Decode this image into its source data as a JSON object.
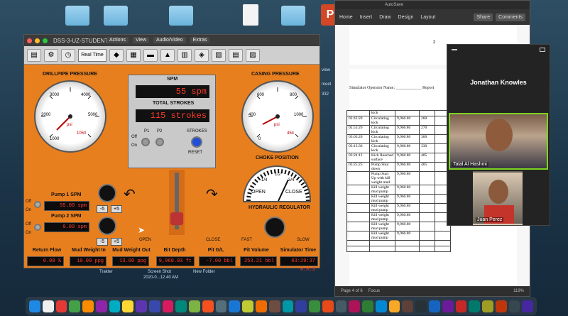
{
  "simulator": {
    "window_title": "DSS-3-UZ-STUDENT1",
    "vnc_menu": [
      "Actions",
      "View",
      "Audio/Video",
      "Extras"
    ],
    "toolbar": {
      "real_time": "Real Time"
    },
    "drillpipe": {
      "label": "DRILLPIPE PRESSURE",
      "value": "1050",
      "ticks": [
        "0",
        "1000",
        "2000",
        "3000",
        "4000",
        "5000",
        "6000"
      ],
      "unit": "psi"
    },
    "casing": {
      "label": "CASING PRESSURE",
      "value": "454",
      "ticks": [
        "0",
        "200",
        "400",
        "600",
        "800",
        "1000",
        "1200"
      ],
      "unit": "psi"
    },
    "spm": {
      "label": "SPM",
      "value": "55 spm"
    },
    "total_strokes": {
      "label": "TOTAL STROKES",
      "value": "115 strokes"
    },
    "p1": "P1",
    "p2": "P2",
    "strokes_reset": "STROKES",
    "reset": "RESET",
    "on": "On",
    "off": "Off",
    "choke": {
      "label": "CHOKE POSITION",
      "open": "OPEN",
      "close": "CLOSE",
      "half": "1/2",
      "q1": "1/4",
      "q3": "3/4"
    },
    "hydraulic": {
      "label": "HYDRAULIC REGULATOR",
      "fast": "FAST",
      "slow": "SLOW"
    },
    "pump1": {
      "label": "Pump 1 SPM",
      "value": "55.00 spm"
    },
    "pump2": {
      "label": "Pump 2 SPM",
      "value": "0.00 spm"
    },
    "minus": "-5",
    "plus": "+5",
    "lever": {
      "open": "OPEN",
      "close": "CLOSE"
    },
    "bottom": [
      {
        "label": "Return Flow",
        "value": "0.00 %"
      },
      {
        "label": "Mud Weight In",
        "value": "10.00 ppg"
      },
      {
        "label": "Mud Weight Out",
        "value": "13.00 ppg"
      },
      {
        "label": "Bit Depth",
        "value": "9,960.03 ft"
      },
      {
        "label": "Pit G/L",
        "value": "-7.00 bbl"
      },
      {
        "label": "Pit Volume",
        "value": "253.21 bbl"
      },
      {
        "label": "Simulator Time",
        "value": "03:29:37 H:M:S"
      }
    ]
  },
  "desktop": {
    "screenshot_label": "Screen Shot",
    "screenshot_date": "2020-0...12.40 AM",
    "trakter": "Trakter",
    "new_folder": "New Folder",
    "side_text": [
      "view",
      "meet",
      "332"
    ]
  },
  "word": {
    "top_title": "AutoSave",
    "ribbon": [
      "Home",
      "Insert",
      "Draw",
      "Design",
      "Layout"
    ],
    "share": "Share",
    "comments": "Comments",
    "page_num": "2",
    "form_line": "Simulator Operator Name: ____________ Report",
    "rows": [
      [
        "",
        "kick",
        ""
      ],
      [
        "02:43:20",
        "Circulating kick",
        "9,960.80",
        "260"
      ],
      [
        "02:53:26",
        "Circulating kick",
        "9,960.80",
        "270"
      ],
      [
        "03:03:20",
        "Circulating kick",
        "9,960.80",
        "300"
      ],
      [
        "03:13:36",
        "Circulating kick",
        "9,960.80",
        "330"
      ],
      [
        "03:24:12",
        "Kick Reached surface",
        "9,960.80",
        "405"
      ],
      [
        "03:25:25",
        "Pump Shut down",
        "9,960.80",
        "405"
      ],
      [
        "",
        "Pump Start Up with kill weight mud",
        "9,960.80",
        ""
      ],
      [
        "",
        "Kill weight mud pump",
        "9,960.80",
        ""
      ],
      [
        "",
        "Kill weight mud pump",
        "9,960.80",
        ""
      ],
      [
        "",
        "Kill weight mud pump",
        "9,960.80",
        ""
      ],
      [
        "",
        "Kill weight mud pump",
        "9,960.80",
        ""
      ],
      [
        "",
        "Kill weight mud pump",
        "9,960.80",
        ""
      ],
      [
        "",
        "Kill weight mud pump",
        "9,960.80",
        ""
      ],
      [
        "",
        "",
        "",
        ""
      ],
      [
        "",
        "",
        "",
        ""
      ]
    ],
    "status": {
      "page": "Page 4 of 6",
      "focus": "Focus",
      "zoom": "119%"
    }
  },
  "zoom": {
    "host": "Jonathan Knowles",
    "p1": "Talal Al Hashmi",
    "p2": "Juan Perez"
  },
  "colors": {
    "sim_orange": "#e87f1f",
    "lcd_red": "#ff3b2a",
    "zoom_green": "#7ed321"
  }
}
